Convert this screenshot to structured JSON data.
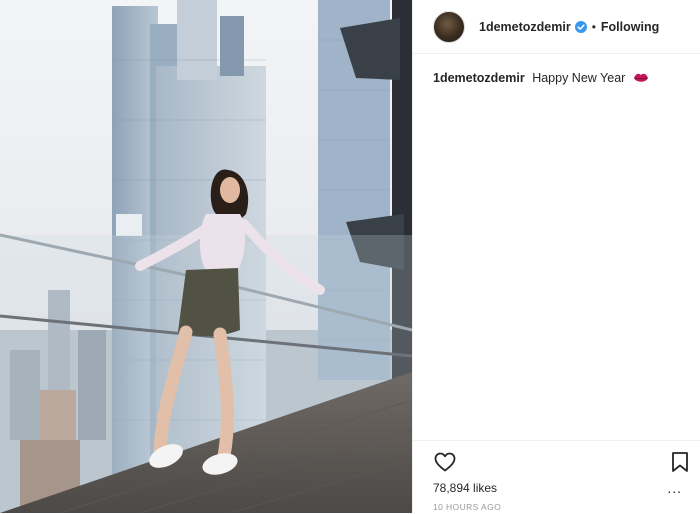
{
  "post": {
    "username": "1demetozdemir",
    "follow_status": "Following",
    "separator": "•",
    "caption_user": "1demetozdemir",
    "caption_text": "Happy New Year",
    "likes": "78,894 likes",
    "time_ago": "10 HOURS AGO",
    "more": "..."
  },
  "icons": {
    "verified": "verified-badge-icon",
    "lips": "lips-emoji-icon",
    "like": "heart-icon",
    "save": "bookmark-icon"
  },
  "colors": {
    "text": "#262626",
    "muted": "#999999",
    "verified": "#3897f0",
    "lips": "#c2185b"
  }
}
